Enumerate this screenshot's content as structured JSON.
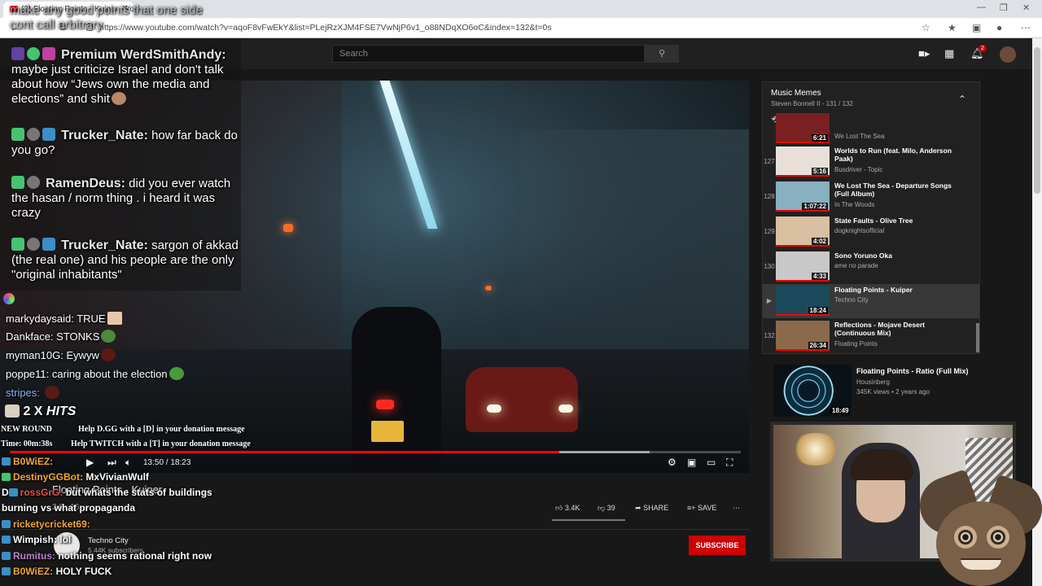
{
  "browser": {
    "tab_title": "(2) Floating Points - Kuiper - Yo...",
    "url": "https://www.youtube.com/watch?v=aqoF8vFwEkY&list=PLejRzXJM4FSE7VwNjP6v1_o88NDqXO6oC&index=132&t=0s"
  },
  "youtube": {
    "search_placeholder": "Search",
    "notification_count": "2",
    "player": {
      "time": "13:50 / 18:23",
      "progress_fraction": 0.752
    },
    "video": {
      "title": "Floating Points - Kuiper",
      "views": "2,0...16",
      "likes": "3.4K",
      "dislikes": "39",
      "share_label": "SHARE",
      "save_label": "SAVE"
    },
    "channel": {
      "name": "Techno City",
      "subscribers": "5.44K subscribers",
      "subscribe_label": "SUBSCRIBE"
    },
    "playlist": {
      "title": "Music Memes",
      "subtitle": "Steven Bonnell II - 131 / 132",
      "items": [
        {
          "index": "",
          "title": "",
          "channel": "We Lost The Sea",
          "duration": "6:21"
        },
        {
          "index": "127",
          "title": "Worlds to Run (feat. Milo, Anderson Paak)",
          "channel": "Busdriver - Topic",
          "duration": "5:16"
        },
        {
          "index": "128",
          "title": "We Lost The Sea - Departure Songs (Full Album)",
          "channel": "In The Woods",
          "duration": "1:07:22"
        },
        {
          "index": "129",
          "title": "State Faults - Olive Tree",
          "channel": "dogknightsofficial",
          "duration": "4:02"
        },
        {
          "index": "130",
          "title": "Sono Yoruno Oka",
          "channel": "ame no parade",
          "duration": "4:33"
        },
        {
          "index": "▶",
          "title": "Floating Points - Kuiper",
          "channel": "Techno City",
          "duration": "18:24"
        },
        {
          "index": "132",
          "title": "Reflections - Mojave Desert (Continuous Mix)",
          "channel": "Floating Points",
          "duration": "26:34"
        }
      ]
    },
    "recommended": {
      "title": "Floating Points - Ratio (Full Mix)",
      "channel": "Housinberg",
      "meta": "345K views • 2 years ago",
      "duration": "18:49"
    }
  },
  "overlay": {
    "ghost_text": "make any good points that one side\ncont call arbitrary",
    "chat_large": [
      {
        "name": "Premium WerdSmithAndy:",
        "message": "maybe just criticize Israel and don't talk about how “Jews own the media and elections” and shit"
      },
      {
        "name": "Trucker_Nate:",
        "message": "how far back do you go?"
      },
      {
        "name": "RamenDeus:",
        "message": "did you ever watch the hasan / norm thing . i heard it was crazy"
      },
      {
        "name": "Trucker_Nate:",
        "message": "sargon of akkad (the real one) and his people are the only \"original inhabitants\""
      }
    ],
    "chat_small": [
      {
        "name": "markydaysaid:",
        "message": "TRUE"
      },
      {
        "name": "Dankface:",
        "message": "STONKS"
      },
      {
        "name": "myman10G:",
        "message": "Eywyw"
      },
      {
        "name": "poppe11:",
        "message": "caring about the election"
      },
      {
        "name": "stripes:",
        "message": ""
      }
    ],
    "hits": {
      "count": "2 X",
      "label": "HITS"
    },
    "round": {
      "new_round": "NEW ROUND",
      "time": "Time: 00m:38s",
      "help_dgg": "Help D.GG with a [D] in your donation message",
      "help_twitch": "Help TWITCH with a [T] in your donation message"
    },
    "dchat": [
      {
        "name": "B0WiEZ:",
        "message": "",
        "color": "#f5a623"
      },
      {
        "name": "DestinyGGBot:",
        "message": "MxVivianWulf",
        "color": "#f5a623"
      },
      {
        "name": "rossGrG:",
        "message": "but whats the stats of buildings",
        "color": "#e05050"
      },
      {
        "name": "",
        "message": "burning vs what propaganda",
        "color": "#ffffff"
      },
      {
        "name": "ricketycricket69:",
        "message": "",
        "color": "#f5a623"
      },
      {
        "name": "Wimpish:",
        "message": "lol",
        "color": "#ffffff"
      },
      {
        "name": "Rumitus:",
        "message": "nothing seems rational right now",
        "color": "#c080d0"
      },
      {
        "name": "B0WiEZ:",
        "message": "HOLY FUCK",
        "color": "#f5a623"
      }
    ],
    "dchat_prefix": "D"
  },
  "colors": {
    "yt_red": "#ff0000",
    "yt_dark": "#181818",
    "twitch_purple": "#6441a5",
    "sub_green": "#45c46f"
  }
}
